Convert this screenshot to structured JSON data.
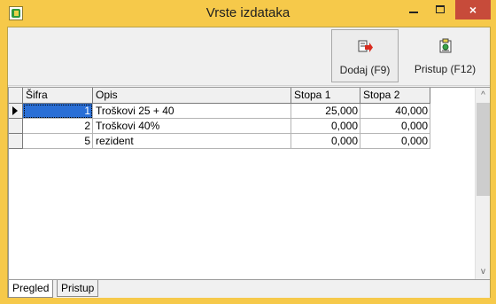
{
  "window": {
    "title": "Vrste izdataka"
  },
  "titlebar": {
    "minimize": "",
    "maximize": "",
    "close": "×"
  },
  "toolbar": {
    "buttons": [
      {
        "label": "Dodaj (F9)",
        "icon": "add-record-icon"
      },
      {
        "label": "Pristup (F12)",
        "icon": "access-icon"
      }
    ]
  },
  "grid": {
    "columns": [
      "Šifra",
      "Opis",
      "Stopa 1",
      "Stopa 2"
    ],
    "rows": [
      {
        "sifra": "1",
        "opis": "Troškovi 25 + 40",
        "stopa1": "25,000",
        "stopa2": "40,000",
        "selected": true
      },
      {
        "sifra": "2",
        "opis": "Troškovi 40%",
        "stopa1": "0,000",
        "stopa2": "0,000",
        "selected": false
      },
      {
        "sifra": "5",
        "opis": "rezident",
        "stopa1": "0,000",
        "stopa2": "0,000",
        "selected": false
      }
    ],
    "scroll": {
      "up": "^",
      "down": "v"
    }
  },
  "tabs": [
    "Pregled",
    "Pristup"
  ],
  "colors": {
    "titlebar": "#f6c94a",
    "close": "#c74b3a",
    "selection": "#2a6fd6"
  }
}
